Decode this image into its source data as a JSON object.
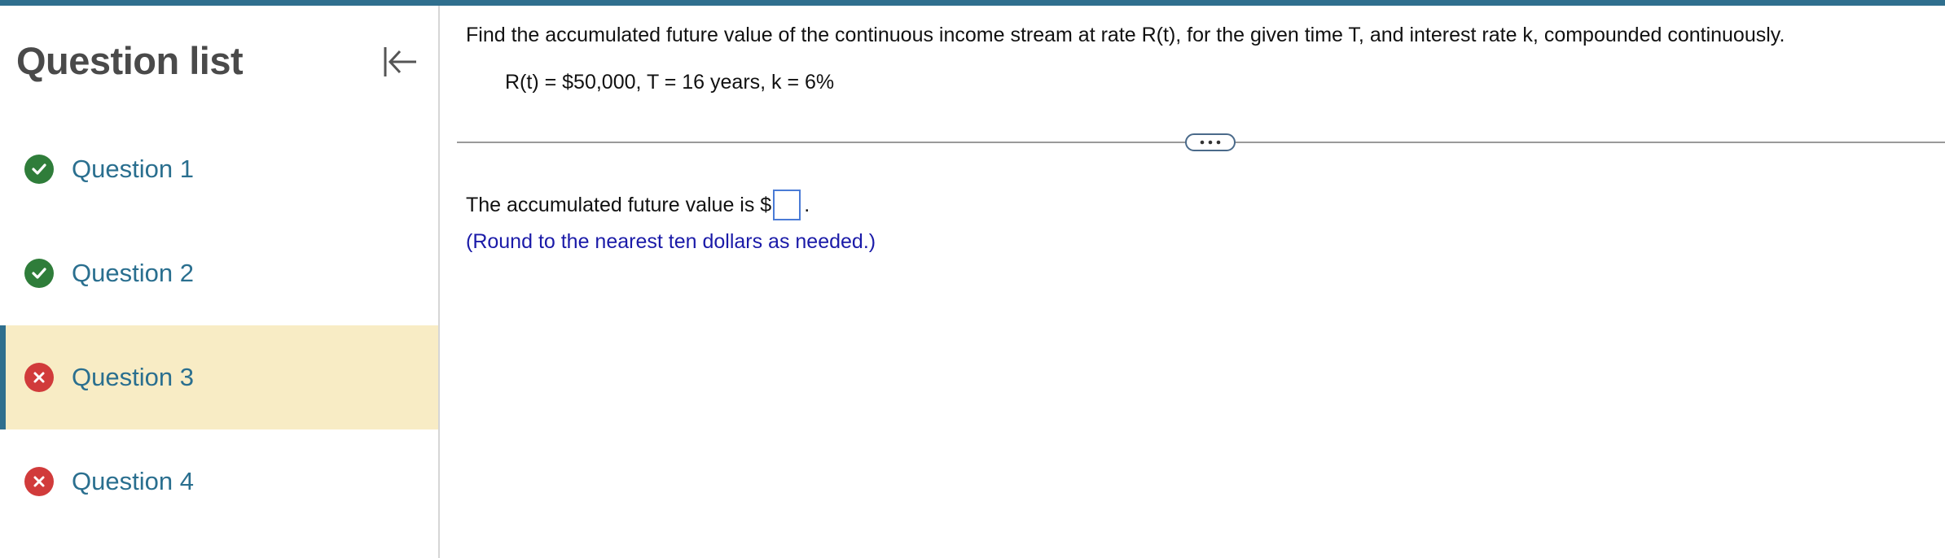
{
  "sidebar": {
    "title": "Question list",
    "collapse_icon": "collapse-left-icon",
    "items": [
      {
        "label": "Question 1",
        "status": "correct",
        "icon": "check-circle-icon"
      },
      {
        "label": "Question 2",
        "status": "correct",
        "icon": "check-circle-icon"
      },
      {
        "label": "Question 3",
        "status": "incorrect",
        "icon": "x-circle-icon",
        "active": true
      },
      {
        "label": "Question 4",
        "status": "incorrect",
        "icon": "x-circle-icon"
      }
    ]
  },
  "question": {
    "prompt": "Find the accumulated future value of the continuous income stream at rate R(t), for the given time T, and interest rate k, compounded continuously.",
    "given": "R(t) = $50,000, T = 16 years, k = 6%",
    "more_icon": "ellipsis-icon",
    "answer_prefix": "The accumulated future value is $",
    "answer_suffix": ".",
    "answer_value": "",
    "hint": "(Round to the nearest ten dollars as needed.)"
  },
  "colors": {
    "accent": "#2f6f8e",
    "active_bg": "#f8ecc5",
    "correct": "#2f7d3a",
    "incorrect": "#d13b3b",
    "link": "#2a6f8f",
    "hint": "#1a1aa8"
  }
}
